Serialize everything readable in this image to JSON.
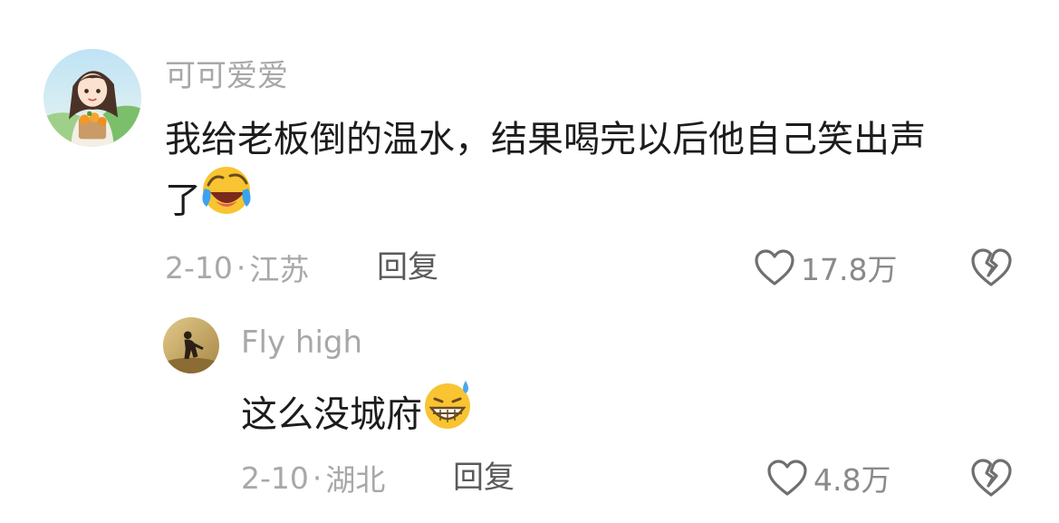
{
  "comments": [
    {
      "username": "可可爱爱",
      "text_line1": "我给老板倒的温水，结果喝完以后他自己笑出声",
      "text_line2": "了",
      "emoji": "laughing-crying-emoji",
      "date": "2-10",
      "separator": "·",
      "location": "江苏",
      "reply_label": "回复",
      "like_count": "17.8万",
      "avatar": "girl-with-oranges-avatar"
    },
    {
      "username": "Fly high",
      "text": "这么没城府",
      "emoji": "grinning-sweat-emoji",
      "date": "2-10",
      "separator": "·",
      "location": "湖北",
      "reply_label": "回复",
      "like_count": "4.8万",
      "avatar": "silhouette-field-avatar"
    }
  ],
  "icons": {
    "like": "heart-outline-icon",
    "dislike": "broken-heart-icon"
  },
  "colors": {
    "username": "#a8a8a8",
    "text": "#1c1c1c",
    "meta": "#a8a8a8",
    "reply": "#5a5a5a",
    "emoji_yellow": "#f9c431"
  }
}
